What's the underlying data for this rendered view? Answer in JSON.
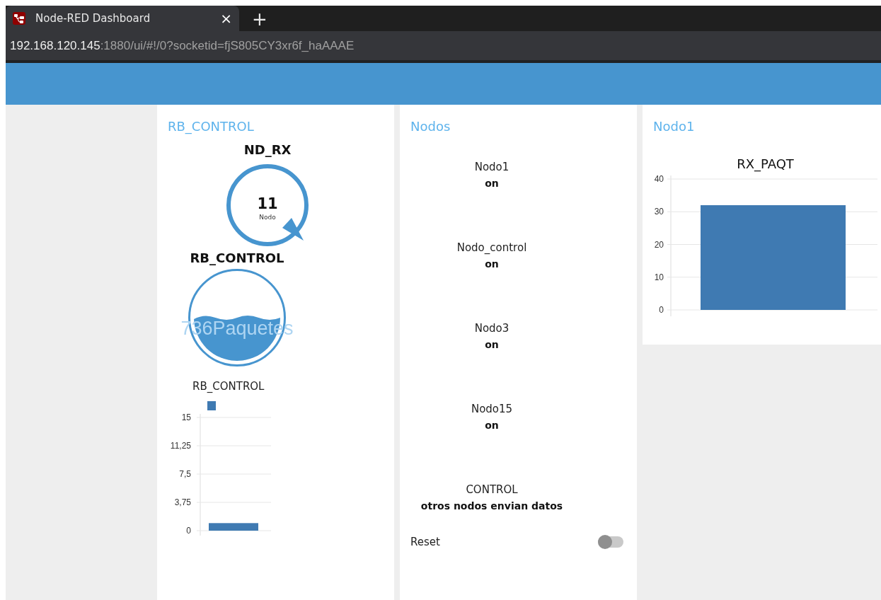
{
  "browser": {
    "tab": {
      "title": "Node-RED Dashboard",
      "close": "×",
      "new_tab": "+"
    },
    "address": {
      "host": "192.168.120.145",
      "path": ":1880/ui/#!/0?socketid=fjS805CY3xr6f_haAAAE"
    }
  },
  "rb_control": {
    "title": "RB_CONTROL",
    "gauge": {
      "label": "ND_RX",
      "value": "11",
      "units": "Nodo"
    },
    "level_gauge": {
      "label": "RB_CONTROL",
      "text": "736Paquetes",
      "level": 0.55
    },
    "chart": {
      "chart_data": {
        "type": "bar",
        "title": "RB_CONTROL",
        "grid": true,
        "values": [
          1
        ],
        "ylim": [
          0,
          15
        ],
        "yticks": [
          0,
          {
            "value": 3.75,
            "label": "3,75"
          },
          {
            "value": 7.5,
            "label": "7,5"
          },
          {
            "value": 11.25,
            "label": "11,25"
          },
          15
        ]
      }
    }
  },
  "nodos": {
    "title": "Nodos",
    "items": [
      {
        "label": "Nodo1",
        "value": "on"
      },
      {
        "label": "Nodo_control",
        "value": "on"
      },
      {
        "label": "Nodo3",
        "value": "on"
      },
      {
        "label": "Nodo15",
        "value": "on"
      },
      {
        "label": "CONTROL",
        "value": "otros nodos envian datos"
      }
    ],
    "switch": {
      "label": "Reset",
      "on": false
    }
  },
  "nodo1": {
    "title": "Nodo1",
    "chart": {
      "chart_data": {
        "type": "bar",
        "title": "RX_PAQT",
        "grid": true,
        "values": [
          32
        ],
        "ylim": [
          0,
          40
        ],
        "yticks": [
          0,
          10,
          20,
          30,
          40
        ]
      }
    }
  }
}
